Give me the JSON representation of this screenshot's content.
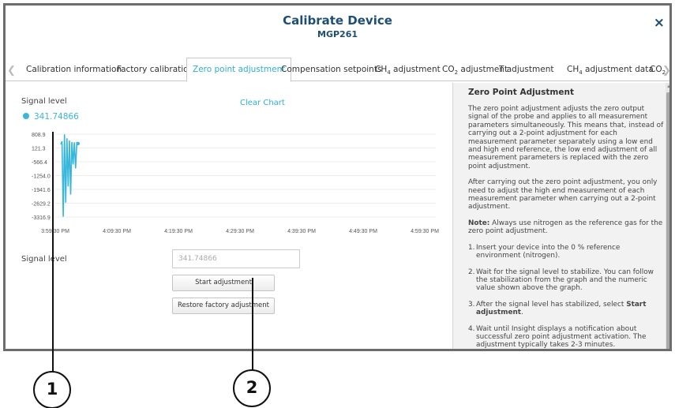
{
  "dialog": {
    "title": "Calibrate Device",
    "subtitle": "MGP261",
    "close_icon": "×"
  },
  "tabs": [
    {
      "label": "Calibration information"
    },
    {
      "label": "Factory calibration"
    },
    {
      "label": "Zero point adjustment",
      "active": true
    },
    {
      "label": "Compensation setpoints"
    },
    {
      "label_prefix": "CH",
      "label_sub": "4",
      "label_suffix": " adjustment"
    },
    {
      "label_prefix": "CO",
      "label_sub": "2",
      "label_suffix": " adjustment"
    },
    {
      "label": "T adjustment"
    },
    {
      "label_prefix": "CH",
      "label_sub": "4",
      "label_suffix": " adjustment data"
    },
    {
      "label_prefix": "CO",
      "label_sub": "2",
      "label_suffix": ""
    }
  ],
  "signal": {
    "label": "Signal level",
    "value": "341.74866",
    "clear_chart": "Clear Chart",
    "color": "#37b7dc"
  },
  "chart_data": {
    "type": "line",
    "y_ticks": [
      "808.9",
      "121.3",
      "-566.4",
      "-1254.0",
      "-1941.6",
      "-2629.2",
      "-3316.9"
    ],
    "x_ticks": [
      "3:59:30 PM",
      "4:09:30 PM",
      "4:19:30 PM",
      "4:29:30 PM",
      "4:39:30 PM",
      "4:49:30 PM",
      "4:59:30 PM"
    ],
    "ylim": [
      -3316.9,
      808.9
    ],
    "series": [
      {
        "color": "#37b7dc",
        "points": [
          [
            0.0,
            300
          ],
          [
            0.2,
            450
          ],
          [
            0.4,
            -3300
          ],
          [
            0.6,
            800
          ],
          [
            0.8,
            -2600
          ],
          [
            1.0,
            600
          ],
          [
            1.2,
            -1800
          ],
          [
            1.4,
            500
          ],
          [
            1.6,
            -2200
          ],
          [
            1.8,
            420
          ],
          [
            2.0,
            -700
          ],
          [
            2.2,
            400
          ],
          [
            2.4,
            -900
          ],
          [
            2.6,
            380
          ],
          [
            2.8,
            341
          ]
        ]
      }
    ]
  },
  "form": {
    "label": "Signal level",
    "input_value": "341.74866",
    "start_button": "Start adjustment",
    "restore_button": "Restore factory adjustment"
  },
  "help": {
    "title": "Zero Point Adjustment",
    "p1": "The zero point adjustment adjusts the zero output signal of the probe and applies to all measurement parameters simultaneously. This means that, instead of carrying out a 2-point adjustment for each measurement parameter separately using a low end and high end reference, the low end adjustment of all measurement parameters is replaced with the zero point adjustment.",
    "p2": "After carrying out the zero point adjustment, you only need to adjust the high end measurement of each measurement parameter when carrying out a 2-point adjustment.",
    "note_label": "Note:",
    "note_text": " Always use nitrogen as the reference gas for the zero point adjustment.",
    "steps": [
      {
        "num": "1.",
        "text": "Insert your device into the 0 % reference environment (nitrogen)."
      },
      {
        "num": "2.",
        "text": "Wait for the signal level to stabilize. You can follow the stabilization from the graph and the numeric value shown above the graph."
      },
      {
        "num": "3.",
        "text_before": "After the signal level has stabilized, select ",
        "bold": "Start adjustment",
        "text_after": "."
      },
      {
        "num": "4.",
        "text": "Wait until Insight displays a notification about successful zero point adjustment activation. The adjustment typically takes 2-3 minutes."
      }
    ]
  },
  "callouts": [
    {
      "label": "1"
    },
    {
      "label": "2"
    }
  ]
}
